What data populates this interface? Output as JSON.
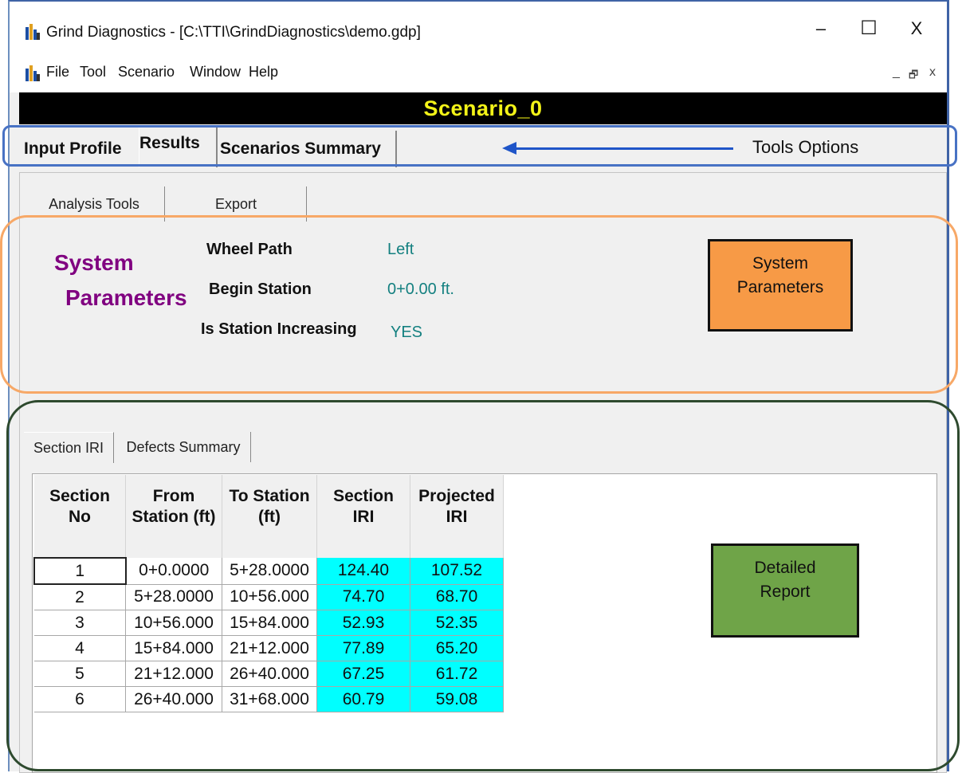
{
  "window": {
    "title": "Grind Diagnostics - [C:\\TTI\\GrindDiagnostics\\demo.gdp]",
    "minimize": "–",
    "maximize": "☐",
    "close": "X"
  },
  "menu": {
    "items": [
      "File",
      "Tool",
      "Scenario",
      "Window",
      "Help"
    ],
    "mdi_minimize": "_",
    "mdi_restore": "🗗",
    "mdi_close": "x"
  },
  "banner": {
    "title": "Scenario_0"
  },
  "top_tabs": [
    "Input Profile",
    "Results",
    "Scenarios Summary"
  ],
  "tools_annotation": "Tools Options",
  "sub_tabs": [
    "Analysis Tools",
    "Export"
  ],
  "system_parameters": {
    "title_line1": "System",
    "title_line2": "Parameters",
    "rows": [
      {
        "label": "Wheel Path",
        "value": "Left"
      },
      {
        "label": "Begin Station",
        "value": "0+0.00 ft."
      },
      {
        "label": "Is Station Increasing",
        "value": "YES"
      }
    ],
    "callout_line1": "System",
    "callout_line2": "Parameters"
  },
  "detail_tabs": [
    "Section IRI",
    "Defects Summary"
  ],
  "section_table": {
    "headers": [
      [
        "Section",
        "No"
      ],
      [
        "From",
        "Station (ft)"
      ],
      [
        "To Station",
        "(ft)"
      ],
      [
        "Section",
        "IRI"
      ],
      [
        "Projected",
        "IRI"
      ]
    ],
    "rows": [
      [
        "1",
        "0+0.0000",
        "5+28.0000",
        "124.40",
        "107.52"
      ],
      [
        "2",
        "5+28.0000",
        "10+56.000",
        "74.70",
        "68.70"
      ],
      [
        "3",
        "10+56.000",
        "15+84.000",
        "52.93",
        "52.35"
      ],
      [
        "4",
        "15+84.000",
        "21+12.000",
        "77.89",
        "65.20"
      ],
      [
        "5",
        "21+12.000",
        "26+40.000",
        "67.25",
        "61.72"
      ],
      [
        "6",
        "26+40.000",
        "31+68.000",
        "60.79",
        "59.08"
      ]
    ]
  },
  "detail_callout": {
    "line1": "Detailed",
    "line2": "Report"
  },
  "colors": {
    "banner_text": "#f3f318",
    "iri_cells": "#00ffff",
    "system_title": "#800080",
    "param_value": "#148080",
    "sp_callout": "#f79a46",
    "detail_callout": "#6fa448",
    "tools_outline": "#4872c4",
    "sp_outline": "#f7a867",
    "detail_outline": "#2e4a2e"
  }
}
